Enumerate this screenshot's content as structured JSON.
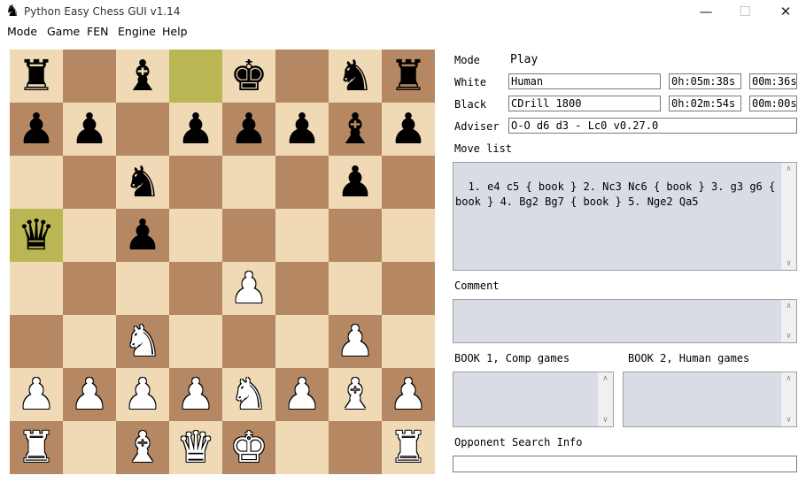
{
  "window": {
    "title": "Python Easy Chess GUI v1.14",
    "minimize": "—",
    "maximize": "☐",
    "close": "✕"
  },
  "menu": {
    "items": [
      "Mode",
      "Game",
      "FEN",
      "Engine",
      "Help"
    ]
  },
  "board": {
    "light_color": "#f0d9b5",
    "dark_color": "#b58863",
    "highlight_color": "#bbb654",
    "highlights": [
      "d8",
      "a5"
    ],
    "position": [
      [
        "bR",
        "",
        "bB",
        "",
        "bK",
        "",
        "bN",
        "bR"
      ],
      [
        "bP",
        "bP",
        "",
        "bP",
        "bP",
        "bP",
        "bB",
        "bP"
      ],
      [
        "",
        "",
        "bN",
        "",
        "",
        "",
        "bP",
        ""
      ],
      [
        "bQ",
        "",
        "bP",
        "",
        "",
        "",
        "",
        ""
      ],
      [
        "",
        "",
        "",
        "",
        "wP",
        "",
        "",
        ""
      ],
      [
        "",
        "",
        "wN",
        "",
        "",
        "",
        "wP",
        ""
      ],
      [
        "wP",
        "wP",
        "wP",
        "wP",
        "wN",
        "wP",
        "wB",
        "wP"
      ],
      [
        "wR",
        "",
        "wB",
        "wQ",
        "wK",
        "",
        "",
        "wR"
      ]
    ]
  },
  "panel": {
    "mode_label": "Mode",
    "mode_value": "Play",
    "white_label": "White",
    "white_player": "Human",
    "white_clock": "0h:05m:38s",
    "white_move_time": "00m:36s",
    "black_label": "Black",
    "black_player": "CDrill 1800",
    "black_clock": "0h:02m:54s",
    "black_move_time": "00m:00s",
    "adviser_label": "Adviser",
    "adviser_value": "O-O d6 d3 - Lc0 v0.27.0",
    "move_list_label": "Move list",
    "move_list": "1. e4 c5 { book } 2. Nc3 Nc6 { book } 3. g3 g6 {\nbook } 4. Bg2 Bg7 { book } 5. Nge2 Qa5",
    "comment_label": "Comment",
    "comment": "",
    "book1_label": "BOOK 1, Comp games",
    "book1": "",
    "book2_label": "BOOK 2, Human games",
    "book2": "",
    "search_info_label": "Opponent Search Info",
    "search_info": ""
  }
}
